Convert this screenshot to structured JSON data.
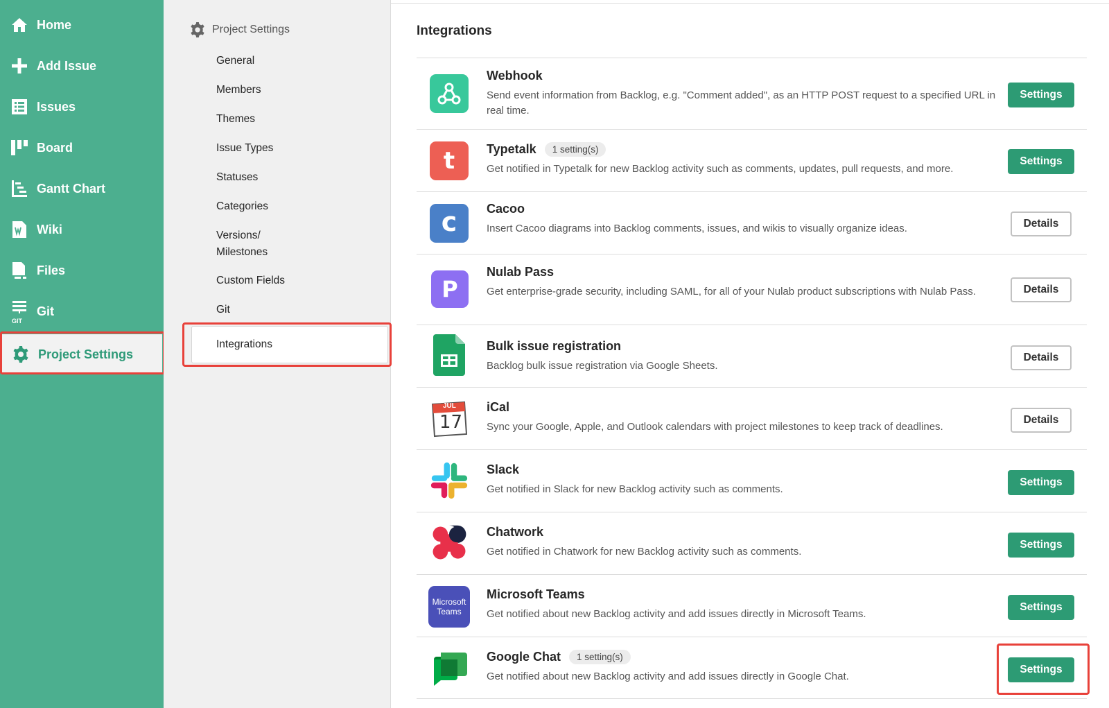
{
  "sidebar": {
    "items": [
      {
        "label": "Home",
        "icon": "home-icon"
      },
      {
        "label": "Add Issue",
        "icon": "plus-icon"
      },
      {
        "label": "Issues",
        "icon": "list-icon"
      },
      {
        "label": "Board",
        "icon": "board-icon"
      },
      {
        "label": "Gantt Chart",
        "icon": "gantt-icon"
      },
      {
        "label": "Wiki",
        "icon": "wiki-icon"
      },
      {
        "label": "Files",
        "icon": "files-icon"
      },
      {
        "label": "Git",
        "icon": "git-icon",
        "icon_text": "GIT"
      },
      {
        "label": "Project Settings",
        "icon": "gear-icon",
        "active": true
      }
    ]
  },
  "submenu": {
    "heading": "Project Settings",
    "items": [
      {
        "label": "General"
      },
      {
        "label": "Members"
      },
      {
        "label": "Themes"
      },
      {
        "label": "Issue Types"
      },
      {
        "label": "Statuses"
      },
      {
        "label": "Categories"
      },
      {
        "label": "Versions/ Milestones"
      },
      {
        "label": "Custom Fields"
      },
      {
        "label": "Git"
      },
      {
        "label": "Integrations",
        "active": true
      }
    ]
  },
  "main": {
    "title": "Integrations",
    "integrations": [
      {
        "name": "Webhook",
        "badge": "",
        "description": "Send event information from Backlog, e.g. \"Comment added\", as an HTTP POST request to a specified URL in real time.",
        "button": "Settings",
        "button_type": "settings",
        "icon": "webhook-icon"
      },
      {
        "name": "Typetalk",
        "badge": "1 setting(s)",
        "description": "Get notified in Typetalk for new Backlog activity such as comments, updates, pull requests, and more.",
        "button": "Settings",
        "button_type": "settings",
        "icon": "typetalk-icon",
        "icon_text": "t"
      },
      {
        "name": "Cacoo",
        "badge": "",
        "description": "Insert Cacoo diagrams into Backlog comments, issues, and wikis to visually organize ideas.",
        "button": "Details",
        "button_type": "details",
        "icon": "cacoo-icon",
        "icon_text": "c"
      },
      {
        "name": "Nulab Pass",
        "badge": "",
        "description": "Get enterprise-grade security, including SAML, for all of your Nulab product subscriptions with Nulab Pass.",
        "button": "Details",
        "button_type": "details",
        "icon": "nulab-pass-icon",
        "icon_text": "P"
      },
      {
        "name": "Bulk issue registration",
        "badge": "",
        "description": "Backlog bulk issue registration via Google Sheets.",
        "button": "Details",
        "button_type": "details",
        "icon": "google-sheets-icon"
      },
      {
        "name": "iCal",
        "badge": "",
        "description": "Sync your Google, Apple, and Outlook calendars with project milestones to keep track of deadlines.",
        "button": "Details",
        "button_type": "details",
        "icon": "ical-icon",
        "icon_month": "JUL",
        "icon_day": "17"
      },
      {
        "name": "Slack",
        "badge": "",
        "description": "Get notified in Slack for new Backlog activity such as comments.",
        "button": "Settings",
        "button_type": "settings",
        "icon": "slack-icon"
      },
      {
        "name": "Chatwork",
        "badge": "",
        "description": "Get notified in Chatwork for new Backlog activity such as comments.",
        "button": "Settings",
        "button_type": "settings",
        "icon": "chatwork-icon"
      },
      {
        "name": "Microsoft Teams",
        "badge": "",
        "description": "Get notified about new Backlog activity and add issues directly in Microsoft Teams.",
        "button": "Settings",
        "button_type": "settings",
        "icon": "microsoft-teams-icon",
        "icon_text_1": "Microsoft",
        "icon_text_2": "Teams"
      },
      {
        "name": "Google Chat",
        "badge": "1 setting(s)",
        "description": "Get notified about new Backlog activity and add issues directly in Google Chat.",
        "button": "Settings",
        "button_type": "settings",
        "icon": "google-chat-icon"
      }
    ]
  },
  "colors": {
    "sidebar_bg": "#4caf8f",
    "accent_green": "#2d9b74",
    "highlight_red": "#e8413a"
  }
}
